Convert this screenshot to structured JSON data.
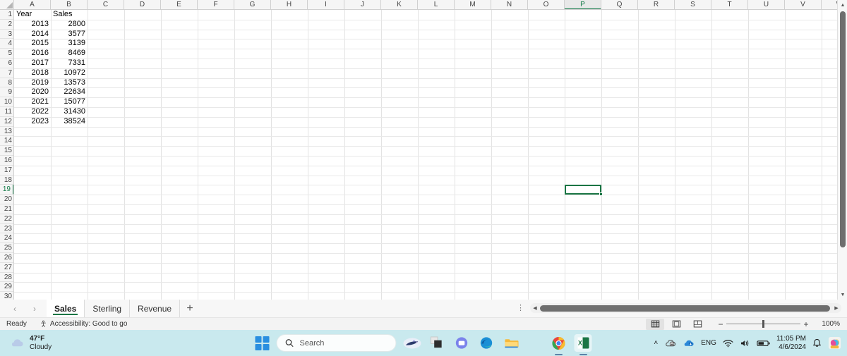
{
  "spreadsheet": {
    "columns": [
      "A",
      "B",
      "C",
      "D",
      "E",
      "F",
      "G",
      "H",
      "I",
      "J",
      "K",
      "L",
      "M",
      "N",
      "O",
      "P",
      "Q",
      "R",
      "S",
      "T",
      "U",
      "V",
      "W"
    ],
    "active_column": "P",
    "active_row": 19,
    "selected_cell": "P19",
    "first_row": 1,
    "last_row": 30,
    "headers": {
      "a": "Year",
      "b": "Sales"
    },
    "rows": [
      {
        "row": 2,
        "year": "2013",
        "sales": "2800"
      },
      {
        "row": 3,
        "year": "2014",
        "sales": "3577"
      },
      {
        "row": 4,
        "year": "2015",
        "sales": "3139"
      },
      {
        "row": 5,
        "year": "2016",
        "sales": "8469"
      },
      {
        "row": 6,
        "year": "2017",
        "sales": "7331"
      },
      {
        "row": 7,
        "year": "2018",
        "sales": "10972"
      },
      {
        "row": 8,
        "year": "2019",
        "sales": "13573"
      },
      {
        "row": 9,
        "year": "2020",
        "sales": "22634"
      },
      {
        "row": 10,
        "year": "2021",
        "sales": "15077"
      },
      {
        "row": 11,
        "year": "2022",
        "sales": "31430"
      },
      {
        "row": 12,
        "year": "2023",
        "sales": "38524"
      }
    ]
  },
  "sheet_tabs": {
    "prev_label": "‹",
    "next_label": "›",
    "add_label": "+",
    "tabs": [
      {
        "label": "Sales",
        "active": true
      },
      {
        "label": "Sterling",
        "active": false
      },
      {
        "label": "Revenue",
        "active": false
      }
    ]
  },
  "status_bar": {
    "ready": "Ready",
    "accessibility": "Accessibility: Good to go",
    "view_normal": "normal-view-icon",
    "view_page_layout": "page-layout-view-icon",
    "view_page_break": "page-break-view-icon",
    "zoom_out": "−",
    "zoom_in": "+",
    "zoom_level": "100%"
  },
  "taskbar": {
    "weather": {
      "temperature": "47°F",
      "condition": "Cloudy",
      "icon": "cloud-icon"
    },
    "search_placeholder": "Search",
    "apps": [
      {
        "name": "copilot-taskbar-icon"
      },
      {
        "name": "task-view-icon"
      },
      {
        "name": "teams-icon"
      },
      {
        "name": "edge-icon"
      },
      {
        "name": "file-explorer-icon"
      },
      {
        "name": "chrome-icon"
      },
      {
        "name": "excel-icon"
      }
    ],
    "tray": {
      "chevron": "˄",
      "language": "ENG",
      "time": "11:05 PM",
      "date": "4/6/2024"
    }
  },
  "colors": {
    "excel_green": "#1a7544",
    "taskbar_bg": "#c9e9ee",
    "header_bg": "#f5f5f5",
    "gridline": "#e3e3e3"
  }
}
